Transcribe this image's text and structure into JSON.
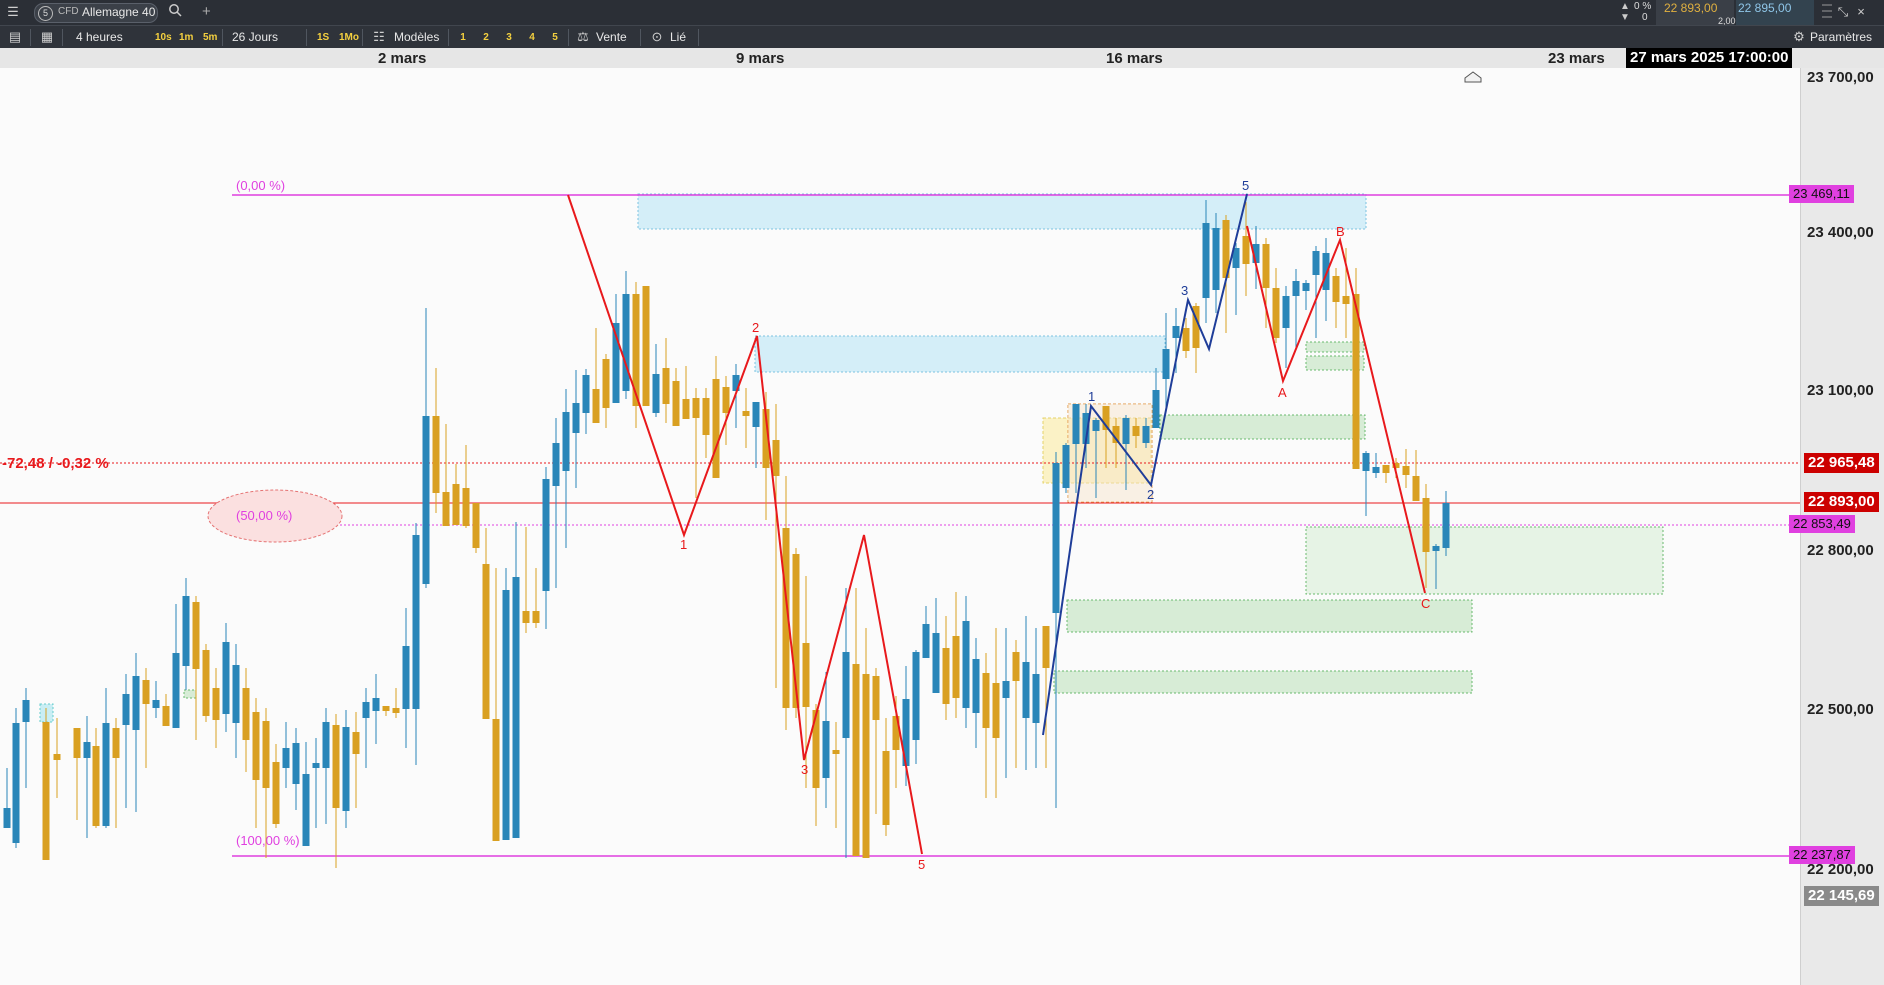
{
  "header": {
    "instrument_badge": "5",
    "instrument_type": "CFD",
    "instrument_name": "Allemagne 40",
    "add_tab": "+",
    "counter_pct": "0 %",
    "counter_val": "0",
    "bid": "22 893,00",
    "spread": "2,00",
    "ask": "22 895,00"
  },
  "toolbar": {
    "timeframe": "4 heures",
    "intervals": [
      "10s",
      "1m",
      "5m"
    ],
    "range": "26 Jours",
    "periods": [
      "1S",
      "1Mo"
    ],
    "templates": "Modèles",
    "template_slots": [
      "1",
      "2",
      "3",
      "4",
      "5"
    ],
    "sell": "Vente",
    "linked": "Lié",
    "settings": "Paramètres"
  },
  "date_axis": {
    "labels": [
      "2 mars",
      "9 mars",
      "16 mars",
      "23 mars"
    ],
    "cursor": "27 mars 2025 17:00:00"
  },
  "price_axis": {
    "ticks": [
      "23 700,00",
      "23 400,00",
      "23 100,00",
      "22 800,00",
      "22 500,00",
      "22 200,00"
    ],
    "fib_top": "23 469,11",
    "prev_close": "22 965,48",
    "last": "22 893,00",
    "fib_mid": "22 853,49",
    "fib_bottom": "22 237,87",
    "crosshair": "22 145,69"
  },
  "annotations": {
    "change": "-72,48 / -0,32 %",
    "fib_0": "(0,00 %)",
    "fib_50": "(50,00 %)",
    "fib_100": "(100,00 %)"
  },
  "waves_red": [
    "1",
    "2",
    "3",
    "5"
  ],
  "waves_blue": [
    "1",
    "2",
    "3",
    "5"
  ],
  "waves_abc": [
    "A",
    "B",
    "C"
  ],
  "colors": {
    "up": "#2a86b8",
    "down": "#d9a021",
    "fib": "#e040e0",
    "red": "#e8191c",
    "blue": "#1f3d99",
    "price_tag": "#cc0000"
  }
}
